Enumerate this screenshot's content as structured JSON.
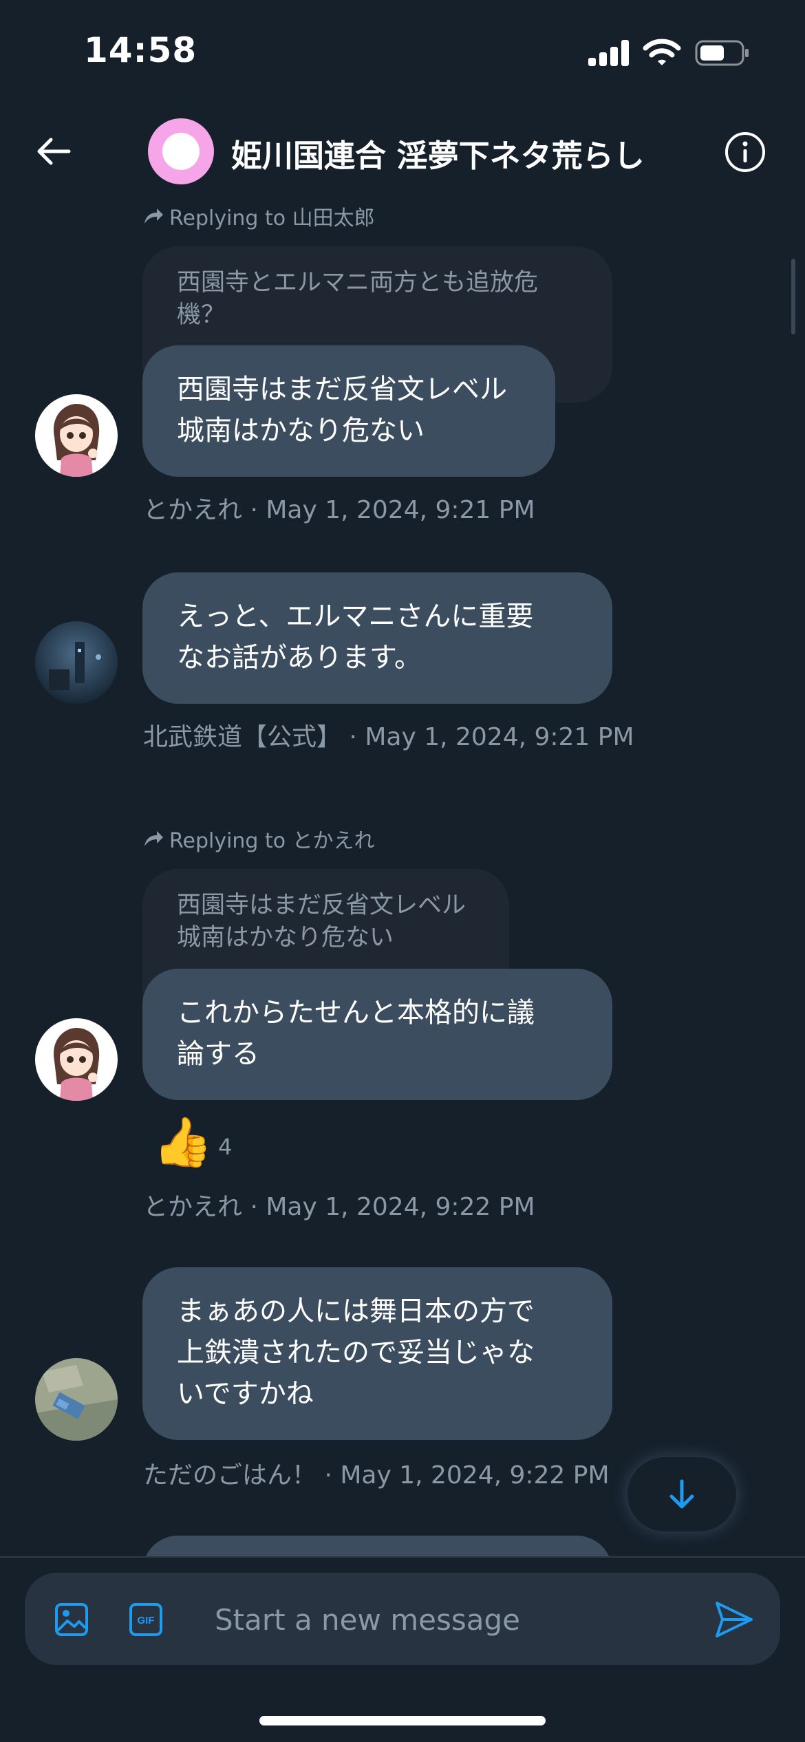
{
  "status_bar": {
    "time": "14:58"
  },
  "header": {
    "title": "姫川国連合 淫夢下ネタ荒らし",
    "avatar_color": "#f6a6e8"
  },
  "messages": [
    {
      "reply_label": "Replying to 山田太郎",
      "quoted_lines": [
        "西園寺とエルマニ両方とも追放危",
        "機？"
      ],
      "text_lines": [
        "西園寺はまだ反省文レベル",
        "城南はかなり危ない"
      ],
      "meta": "とかえれ · May 1, 2024, 9:21 PM",
      "avatar": "anime-girl-avatar"
    },
    {
      "text_lines": [
        "えっと、エルマニさんに重要",
        "なお話があります。"
      ],
      "meta": "北武鉄道【公式】 · May 1, 2024, 9:21 PM",
      "avatar": "night-scene-avatar"
    },
    {
      "reply_label": "Replying to とかえれ",
      "quoted_lines": [
        "西園寺はまだ反省文レベル",
        "城南はかなり危ない"
      ],
      "text_lines": [
        "これからたせんと本格的に議",
        "論する"
      ],
      "reaction": {
        "emoji": "👍",
        "count": "4"
      },
      "meta": "とかえれ · May 1, 2024, 9:22 PM",
      "avatar": "anime-girl-avatar"
    },
    {
      "text_lines": [
        "まぁあの人には舞日本の方で",
        "上鉄潰されたので妥当じゃな",
        "いですかね"
      ],
      "meta": "ただのごはん！ · May 1, 2024, 9:22 PM",
      "avatar": "aerial-photo-avatar"
    }
  ],
  "composer": {
    "placeholder": "Start a new message",
    "gif_label": "GIF"
  },
  "colors": {
    "background": "#15202b",
    "bubble": "#3b4d5e",
    "quoted": "#1e2732",
    "accent": "#1d9bf0",
    "muted": "#8b98a5"
  }
}
